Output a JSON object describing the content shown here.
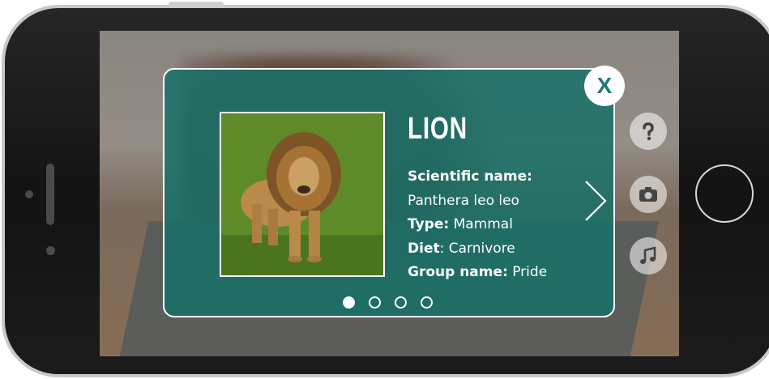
{
  "animal": {
    "name": "LION",
    "facts": [
      {
        "label": "Scientific name:",
        "value": ""
      },
      {
        "label": "",
        "value": "Panthera leo leo"
      },
      {
        "label": "Type:",
        "value": " Mammal"
      },
      {
        "label": "Diet",
        "value": ": Carnivore"
      },
      {
        "label": "Group name:",
        "value": " Pride"
      }
    ]
  },
  "close": {
    "label": "X"
  },
  "pagination": {
    "total": 4,
    "current": 1
  },
  "side_buttons": [
    "help-icon",
    "camera-icon",
    "music-icon"
  ],
  "colors": {
    "card": "#167068",
    "accent": "#1e7e74",
    "border": "#ffffff"
  }
}
